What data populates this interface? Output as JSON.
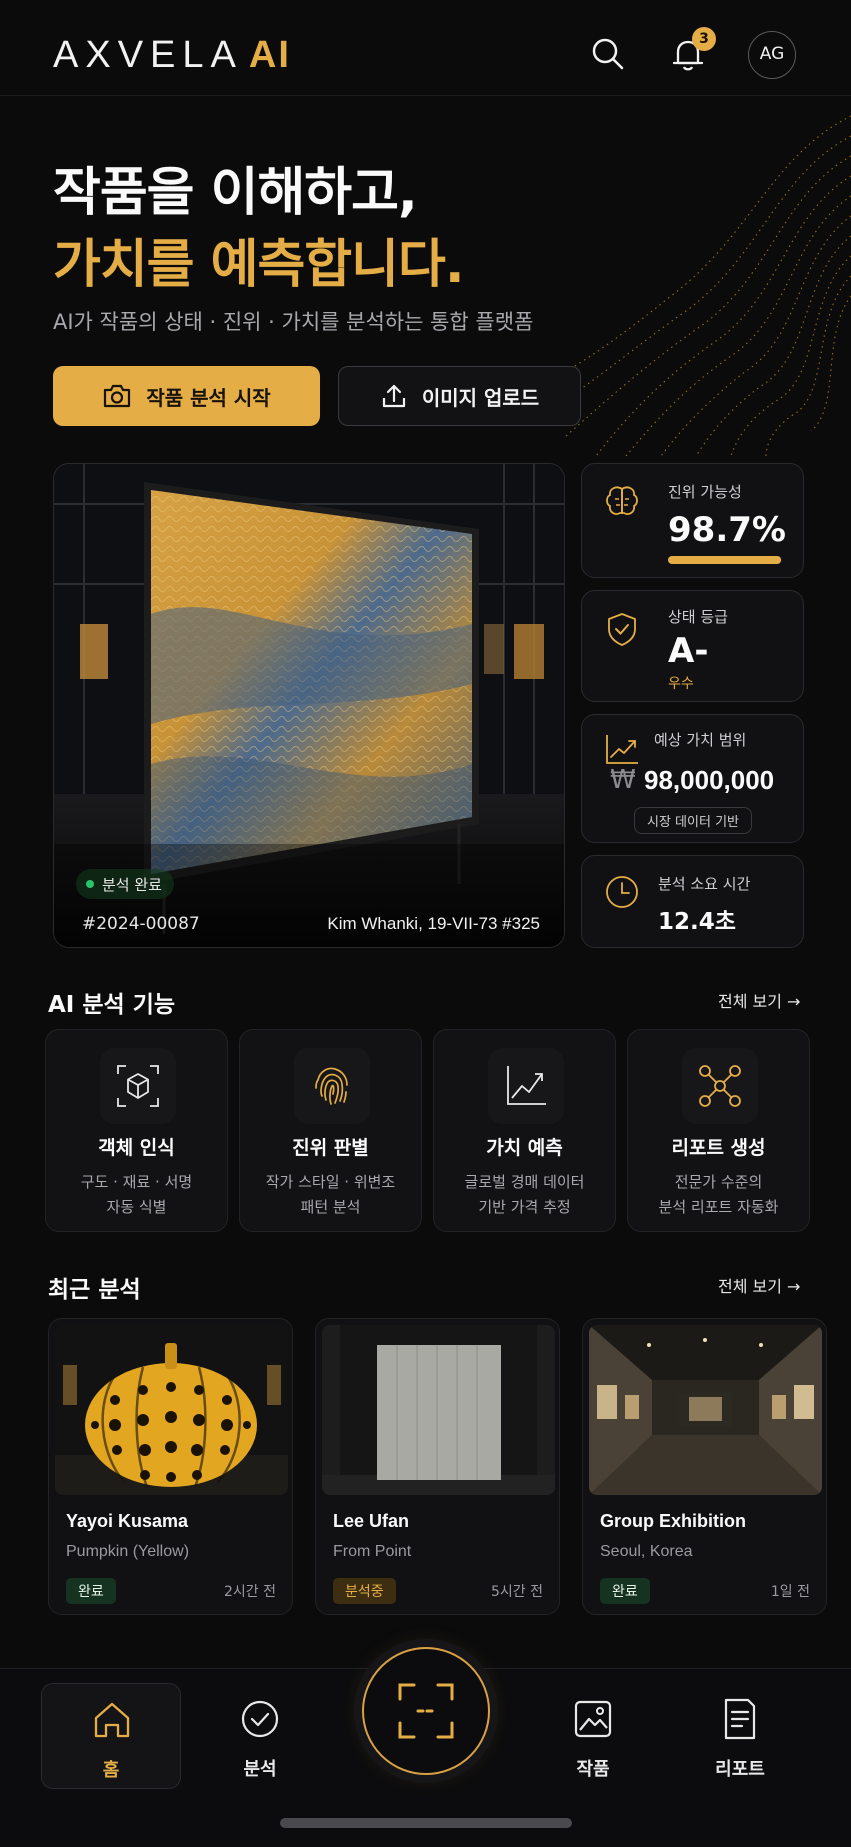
{
  "header": {
    "logo_main": "AXVELA",
    "logo_accent": "AI",
    "notification_count": "3",
    "avatar_initials": "AG",
    "icons": [
      "search-icon",
      "bell-icon"
    ]
  },
  "hero": {
    "title_line1": "작품을 이해하고,",
    "title_line2": "가치를 예측합니다.",
    "subtitle": "AI가 작품의 상태 · 진위 · 가치를 분석하는 통합 플랫폼",
    "primary_button": "작품 분석 시작",
    "secondary_button": "이미지 업로드"
  },
  "artwork": {
    "status": "분석 완료",
    "id": "#2024-00087",
    "title": "Kim Whanki, 19-VII-73 #325"
  },
  "stats": {
    "authenticity": {
      "label": "진위 가능성",
      "value": "98.7%",
      "progress": 0.987
    },
    "condition": {
      "label": "상태 등급",
      "value": "A-",
      "sub": "우수"
    },
    "value_range": {
      "label": "예상 가치 범위",
      "currency": "₩",
      "value": "98,000,000",
      "badge": "시장 데이터 기반"
    },
    "time": {
      "label": "분석 소요 시간",
      "value": "12.4초"
    }
  },
  "features": {
    "title": "AI 분석 기능",
    "view_all": "전체 보기 →",
    "items": [
      {
        "title": "객체 인식",
        "desc1": "구도 · 재료 · 서명",
        "desc2": "자동 식별",
        "icon": "cube-scan-icon"
      },
      {
        "title": "진위 판별",
        "desc1": "작가 스타일 · 위변조",
        "desc2": "패턴 분석",
        "icon": "fingerprint-icon"
      },
      {
        "title": "가치 예측",
        "desc1": "글로벌 경매 데이터",
        "desc2": "기반 가격 추정",
        "icon": "trend-chart-icon"
      },
      {
        "title": "리포트 생성",
        "desc1": "전문가 수준의",
        "desc2": "분석 리포트 자동화",
        "icon": "network-icon"
      }
    ]
  },
  "recent": {
    "title": "최근 분석",
    "view_all": "전체 보기 →",
    "items": [
      {
        "artist": "Yayoi Kusama",
        "work": "Pumpkin (Yellow)",
        "status": "완료",
        "time": "2시간 전"
      },
      {
        "artist": "Lee Ufan",
        "work": "From Point",
        "status": "분석중",
        "time": "5시간 전"
      },
      {
        "artist": "Group Exhibition",
        "work": "Seoul, Korea",
        "status": "완료",
        "time": "1일 전"
      }
    ]
  },
  "nav": {
    "home": "홈",
    "analysis": "분석",
    "works": "작품",
    "reports": "리포트"
  },
  "colors": {
    "accent": "#e4ad46",
    "background": "#0b0b0c",
    "success": "#29c56a"
  }
}
